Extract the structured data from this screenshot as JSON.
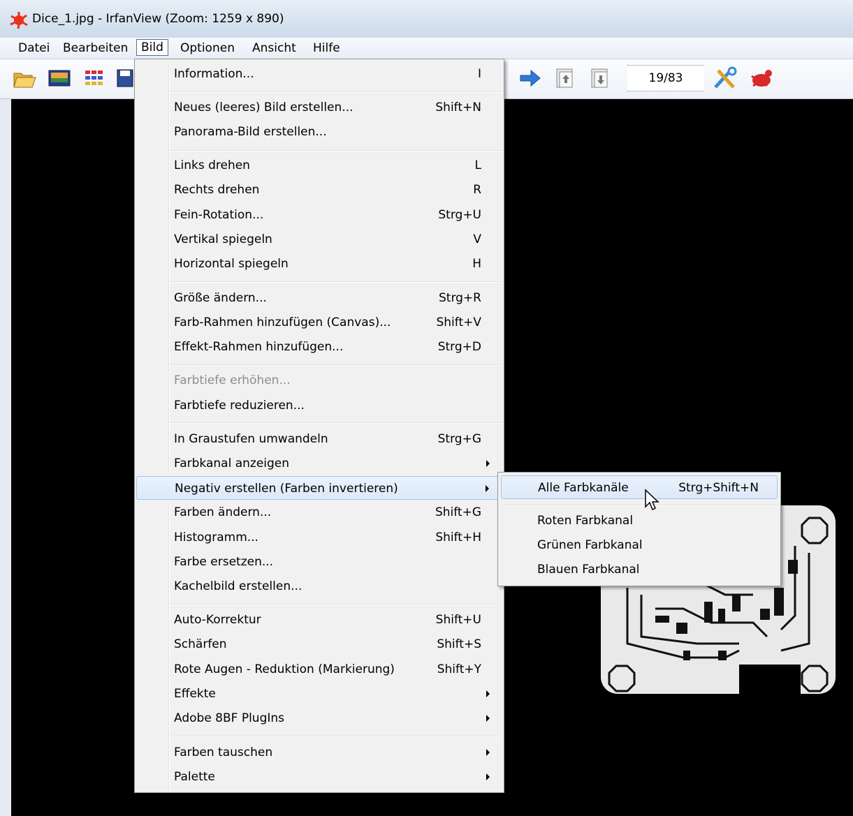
{
  "window": {
    "title": "Dice_1.jpg - IrfanView (Zoom: 1259 x 890)"
  },
  "menubar": [
    "Datei",
    "Bearbeiten",
    "Bild",
    "Optionen",
    "Ansicht",
    "Hilfe"
  ],
  "toolbar": {
    "icons": [
      "open-folder-icon",
      "slideshow-icon",
      "thumbnails-icon",
      "save-icon",
      "next-arrow-icon",
      "first-page-icon",
      "last-page-icon",
      "settings-icon",
      "irfanview-logo-icon"
    ],
    "counter": "19/83"
  },
  "bild_menu": {
    "items": [
      {
        "label": "Information...",
        "shortcut": "I"
      },
      {
        "label": "Neues (leeres) Bild erstellen...",
        "shortcut": "Shift+N"
      },
      {
        "label": "Panorama-Bild erstellen...",
        "shortcut": ""
      },
      {
        "label": "Links drehen",
        "shortcut": "L"
      },
      {
        "label": "Rechts drehen",
        "shortcut": "R"
      },
      {
        "label": "Fein-Rotation...",
        "shortcut": "Strg+U"
      },
      {
        "label": "Vertikal spiegeln",
        "shortcut": "V"
      },
      {
        "label": "Horizontal spiegeln",
        "shortcut": "H"
      },
      {
        "label": "Größe ändern...",
        "shortcut": "Strg+R"
      },
      {
        "label": "Farb-Rahmen hinzufügen (Canvas)...",
        "shortcut": "Shift+V"
      },
      {
        "label": "Effekt-Rahmen hinzufügen...",
        "shortcut": "Strg+D"
      },
      {
        "label": "Farbtiefe erhöhen...",
        "shortcut": "",
        "disabled": true
      },
      {
        "label": "Farbtiefe reduzieren...",
        "shortcut": ""
      },
      {
        "label": "In Graustufen umwandeln",
        "shortcut": "Strg+G"
      },
      {
        "label": "Farbkanal anzeigen",
        "shortcut": "",
        "submenu": true
      },
      {
        "label": "Negativ erstellen (Farben invertieren)",
        "shortcut": "",
        "submenu": true,
        "highlighted": true
      },
      {
        "label": "Farben ändern...",
        "shortcut": "Shift+G"
      },
      {
        "label": "Histogramm...",
        "shortcut": "Shift+H"
      },
      {
        "label": "Farbe ersetzen...",
        "shortcut": ""
      },
      {
        "label": "Kachelbild erstellen...",
        "shortcut": ""
      },
      {
        "label": "Auto-Korrektur",
        "shortcut": "Shift+U"
      },
      {
        "label": "Schärfen",
        "shortcut": "Shift+S"
      },
      {
        "label": "Rote Augen - Reduktion (Markierung)",
        "shortcut": "Shift+Y"
      },
      {
        "label": "Effekte",
        "shortcut": "",
        "submenu": true
      },
      {
        "label": "Adobe 8BF PlugIns",
        "shortcut": "",
        "submenu": true
      },
      {
        "label": "Farben tauschen",
        "shortcut": "",
        "submenu": true
      },
      {
        "label": "Palette",
        "shortcut": "",
        "submenu": true
      }
    ]
  },
  "submenu": {
    "items": [
      {
        "label": "Alle Farbkanäle",
        "shortcut": "Strg+Shift+N",
        "highlighted": true
      },
      {
        "label": "Roten Farbkanal",
        "shortcut": ""
      },
      {
        "label": "Grünen Farbkanal",
        "shortcut": ""
      },
      {
        "label": "Blauen Farbkanal",
        "shortcut": ""
      }
    ]
  },
  "colors": {
    "highlight": "#dce9f9",
    "menu_bg": "#f1f1f1",
    "image_bg": "#000000"
  }
}
